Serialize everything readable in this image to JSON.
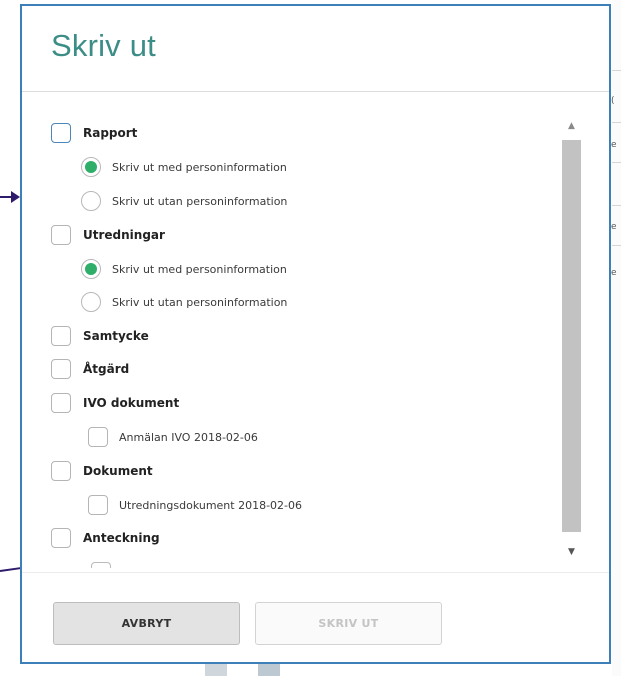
{
  "dialog": {
    "title": "Skriv ut",
    "cancel_label": "AVBRYT",
    "print_label": "SKRIV UT"
  },
  "options": [
    {
      "type": "checkbox",
      "label": "Rapport",
      "checked": false,
      "level": 0
    },
    {
      "type": "radio",
      "label": "Skriv ut med personinformation",
      "selected": true,
      "level": 1
    },
    {
      "type": "radio",
      "label": "Skriv ut utan personinformation",
      "selected": false,
      "level": 1
    },
    {
      "type": "checkbox",
      "label": "Utredningar",
      "checked": false,
      "level": 0
    },
    {
      "type": "radio",
      "label": "Skriv ut med personinformation",
      "selected": true,
      "level": 1
    },
    {
      "type": "radio",
      "label": "Skriv ut utan personinformation",
      "selected": false,
      "level": 1
    },
    {
      "type": "checkbox",
      "label": "Samtycke",
      "checked": false,
      "level": 0
    },
    {
      "type": "checkbox",
      "label": "Åtgärd",
      "checked": false,
      "level": 0
    },
    {
      "type": "checkbox",
      "label": "IVO dokument",
      "checked": false,
      "level": 0
    },
    {
      "type": "checkbox",
      "label": "Anmälan IVO 2018-02-06",
      "checked": false,
      "level": 1
    },
    {
      "type": "checkbox",
      "label": "Dokument",
      "checked": false,
      "level": 0
    },
    {
      "type": "checkbox",
      "label": "Utredningsdokument 2018-02-06",
      "checked": false,
      "level": 1
    },
    {
      "type": "checkbox",
      "label": "Anteckning",
      "checked": false,
      "level": 0
    }
  ],
  "colors": {
    "title": "#3b8d86",
    "radio_selected": "#2fae6a",
    "dialog_border": "#3d7fb8",
    "annotation_arrow": "#2f1b6b"
  },
  "icons": {
    "scroll_up": "▲",
    "scroll_down": "▼"
  },
  "background_fragments": [
    "(",
    "e",
    "e",
    "e"
  ]
}
